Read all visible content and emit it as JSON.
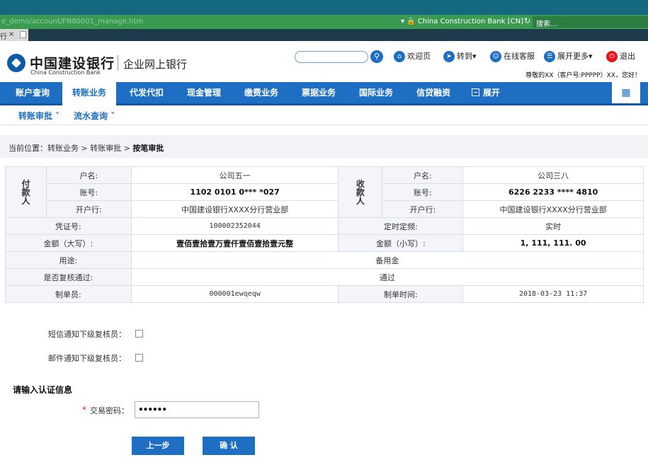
{
  "browser": {
    "url": "e_demo/account/FN80001_manage.htm",
    "site": "China Construction Bank [CN]",
    "search_placeholder": "搜索...",
    "tab_label": "行",
    "tab_close": "×"
  },
  "header": {
    "logo_cn": "中国建设银行",
    "logo_en": "China Construction Bank",
    "subtitle": "企业网上银行",
    "links": [
      {
        "icon": "home-icon",
        "label": "欢迎页"
      },
      {
        "icon": "goto-icon",
        "label": "转到▾"
      },
      {
        "icon": "customer-service-icon",
        "label": "在线客服"
      },
      {
        "icon": "more-icon",
        "label": "展开更多▾"
      },
      {
        "icon": "logout-icon",
        "label": "退出"
      }
    ],
    "user_greeting": "尊敬的XX（客户号:PPPPP）XX，您好！"
  },
  "nav": {
    "items": [
      "账户查询",
      "转账业务",
      "代发代扣",
      "现金管理",
      "缴费业务",
      "票据业务",
      "国际业务",
      "信贷融资"
    ],
    "active": "转账业务",
    "expand_label": "展开",
    "grid_icon": "grid-icon"
  },
  "subnav": {
    "items": [
      "转账审批 ˅",
      "流水查询 ˅"
    ]
  },
  "breadcrumb": {
    "prefix": "当前位置：转账业务 > 转账审批 > ",
    "current": "按笔审批"
  },
  "payer": {
    "head": "付款人",
    "name_label": "户名:",
    "name": "公司五一",
    "acct_label": "账号:",
    "acct": "1102 0101 0*** *027",
    "bank_label": "开户行:",
    "bank": "中国建设银行XXXX分行营业部"
  },
  "payee": {
    "head": "收款人",
    "name_label": "户名:",
    "name": "公司三八",
    "acct_label": "账号:",
    "acct": "6226 2233 **** 4810",
    "bank_label": "开户行:",
    "bank": "中国建设银行XXXX分行营业部"
  },
  "details": {
    "voucher_label": "凭证号:",
    "voucher": "100002352044",
    "freq_label": "定时定频:",
    "freq": "实时",
    "amount_cn_label": "金额（大写）:",
    "amount_cn": "壹佰壹拾壹万壹仟壹佰壹拾壹元整",
    "amount_num_label": "金额（小写）:",
    "amount_num": "1, 111, 111. 00",
    "purpose_label": "用途:",
    "purpose": "备用金",
    "review_label": "是否复核通过:",
    "review": "通过",
    "maker_label": "制单员:",
    "maker": "000001ewqeqw",
    "time_label": "制单时间:",
    "time": "2018-03-23 11:37"
  },
  "notify": {
    "sms_label": "短信通知下级复核员：",
    "email_label": "邮件通知下级复核员："
  },
  "auth": {
    "title": "请输入认证信息",
    "required_mark": "*",
    "pwd_label": "交易密码：",
    "pwd_value": "••••••"
  },
  "buttons": {
    "prev": "上一步",
    "confirm": "确 认"
  }
}
